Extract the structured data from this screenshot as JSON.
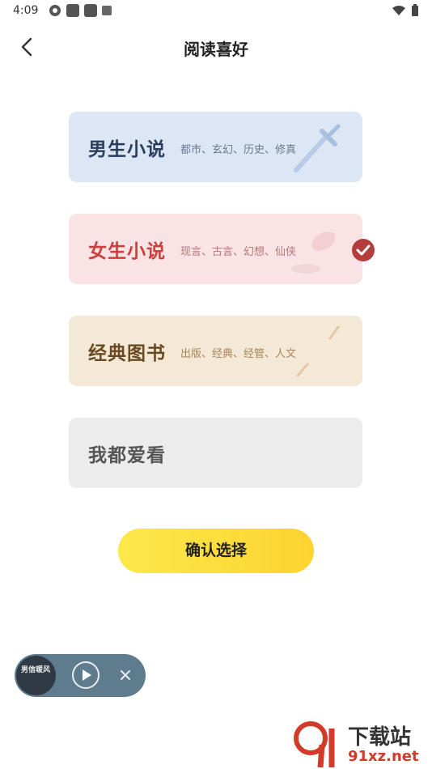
{
  "status_bar": {
    "time": "4:09"
  },
  "header": {
    "title": "阅读喜好"
  },
  "cards": [
    {
      "title": "男生小说",
      "subtitle": "都市、玄幻、历史、修真",
      "selected": false
    },
    {
      "title": "女生小说",
      "subtitle": "现言、古言、幻想、仙侠",
      "selected": true
    },
    {
      "title": "经典图书",
      "subtitle": "出版、经典、经管、人文",
      "selected": false
    },
    {
      "title": "我都爱看",
      "subtitle": "",
      "selected": false
    }
  ],
  "confirm_button": {
    "label": "确认选择"
  },
  "mini_player": {
    "cover_text": "男信暖风"
  },
  "watermark": {
    "text1": "下载站",
    "text2": "91xz.net"
  },
  "colors": {
    "accent": "#fcd430",
    "selected_check": "#b43d3d"
  }
}
